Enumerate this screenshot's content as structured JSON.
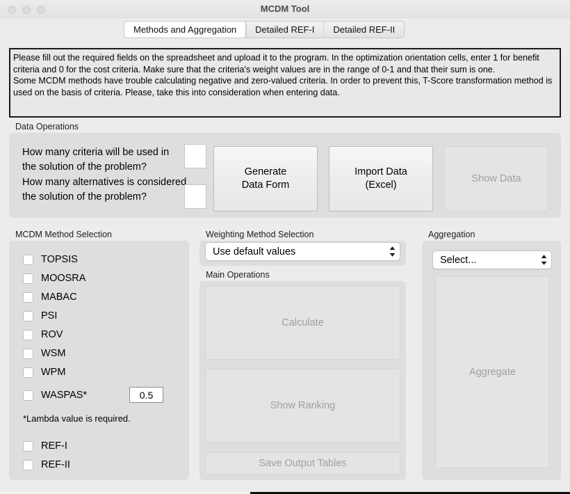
{
  "window": {
    "title": "MCDM Tool",
    "traffic_lights": [
      "close",
      "minimize",
      "maximize"
    ]
  },
  "tabs": [
    {
      "label": "Methods and Aggregation",
      "active": true
    },
    {
      "label": "Detailed REF-I",
      "active": false
    },
    {
      "label": "Detailed REF-II",
      "active": false
    }
  ],
  "instructions": {
    "paragraph1": "Please fill out the required fields on the spreadsheet and upload it to the program. In the optimization orientation cells, enter 1 for benefit criteria and 0 for the cost criteria. Make sure that the criteria's weight values are in the range of 0-1 and that their sum is one.",
    "paragraph2": "Some MCDM methods have trouble calculating negative and zero-valued criteria. In order to prevent this, T-Score transformation method is used on the basis of criteria. Please, take this into consideration when entering data."
  },
  "data_operations": {
    "group_label": "Data Operations",
    "question_criteria": "How many criteria will be used in the solution of the problem?",
    "question_alternatives": "How many alternatives is considered the solution of the problem?",
    "criteria_value": "",
    "alternatives_value": "",
    "buttons": {
      "generate": "Generate\nData Form",
      "generate_line1": "Generate",
      "generate_line2": "Data Form",
      "import_line1": "Import Data",
      "import_line2": "(Excel)",
      "show_data": "Show Data",
      "show_data_enabled": false,
      "generate_enabled": true,
      "import_enabled": true
    }
  },
  "mcdm_method_selection": {
    "group_label": "MCDM Method Selection",
    "methods": [
      {
        "label": "TOPSIS",
        "checked": false
      },
      {
        "label": "MOOSRA",
        "checked": false
      },
      {
        "label": "MABAC",
        "checked": false
      },
      {
        "label": "PSI",
        "checked": false
      },
      {
        "label": "ROV",
        "checked": false
      },
      {
        "label": "WSM",
        "checked": false
      },
      {
        "label": "WPM",
        "checked": false
      },
      {
        "label": "WASPAS*",
        "checked": false
      },
      {
        "label": "REF-I",
        "checked": false
      },
      {
        "label": "REF-II",
        "checked": false
      }
    ],
    "lambda_value": "0.5",
    "lambda_note": "*Lambda value is required."
  },
  "weighting_method_selection": {
    "group_label": "Weighting Method Selection",
    "selected": "Use default values"
  },
  "main_operations": {
    "group_label": "Main Operations",
    "calculate": "Calculate",
    "show_ranking": "Show Ranking",
    "save_output_tables": "Save Output Tables",
    "calculate_enabled": false,
    "show_ranking_enabled": false,
    "save_enabled": false
  },
  "aggregation": {
    "group_label": "Aggregation",
    "selected": "Select...",
    "aggregate_button": "Aggregate",
    "aggregate_enabled": false
  },
  "colors": {
    "window_background": "#ececec",
    "group_background": "#dedede",
    "instruction_background": "#e8e8e8",
    "instruction_border": "#1a1a1a",
    "disabled_text": "#a0a0a0",
    "text": "#000000"
  }
}
